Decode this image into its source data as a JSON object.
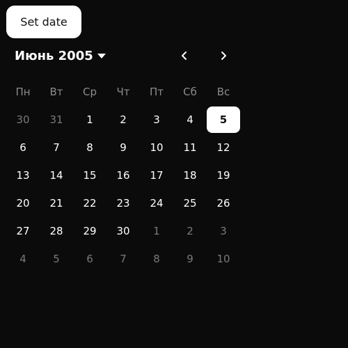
{
  "set_date_button": {
    "label": "Set date"
  },
  "calendar": {
    "month_year": "Июнь 2005",
    "weekdays": [
      "Пн",
      "Вт",
      "Ср",
      "Чт",
      "Пт",
      "Сб",
      "Вс"
    ],
    "selected_day": "5",
    "weeks": [
      [
        {
          "d": "30",
          "m": true
        },
        {
          "d": "31",
          "m": true
        },
        {
          "d": "1",
          "m": false
        },
        {
          "d": "2",
          "m": false
        },
        {
          "d": "3",
          "m": false
        },
        {
          "d": "4",
          "m": false
        },
        {
          "d": "5",
          "m": false,
          "sel": true
        }
      ],
      [
        {
          "d": "6",
          "m": false
        },
        {
          "d": "7",
          "m": false
        },
        {
          "d": "8",
          "m": false
        },
        {
          "d": "9",
          "m": false
        },
        {
          "d": "10",
          "m": false
        },
        {
          "d": "11",
          "m": false
        },
        {
          "d": "12",
          "m": false
        }
      ],
      [
        {
          "d": "13",
          "m": false
        },
        {
          "d": "14",
          "m": false
        },
        {
          "d": "15",
          "m": false
        },
        {
          "d": "16",
          "m": false
        },
        {
          "d": "17",
          "m": false
        },
        {
          "d": "18",
          "m": false
        },
        {
          "d": "19",
          "m": false
        }
      ],
      [
        {
          "d": "20",
          "m": false
        },
        {
          "d": "21",
          "m": false
        },
        {
          "d": "22",
          "m": false
        },
        {
          "d": "23",
          "m": false
        },
        {
          "d": "24",
          "m": false
        },
        {
          "d": "25",
          "m": false
        },
        {
          "d": "26",
          "m": false
        }
      ],
      [
        {
          "d": "27",
          "m": false
        },
        {
          "d": "28",
          "m": false
        },
        {
          "d": "29",
          "m": false
        },
        {
          "d": "30",
          "m": false
        },
        {
          "d": "1",
          "m": true
        },
        {
          "d": "2",
          "m": true
        },
        {
          "d": "3",
          "m": true
        }
      ],
      [
        {
          "d": "4",
          "m": true
        },
        {
          "d": "5",
          "m": true
        },
        {
          "d": "6",
          "m": true
        },
        {
          "d": "7",
          "m": true
        },
        {
          "d": "8",
          "m": true
        },
        {
          "d": "9",
          "m": true
        },
        {
          "d": "10",
          "m": true
        }
      ]
    ]
  },
  "icons": {
    "prev": "chevron-left-icon",
    "next": "chevron-right-icon",
    "dropdown": "caret-down-icon"
  },
  "colors": {
    "background": "#0b0b0b",
    "text": "#ffffff",
    "muted_text": "#7a7a7a",
    "weekday_text": "#8c8c8c",
    "selected_bg": "#ffffff",
    "button_bg": "#ffffff"
  }
}
